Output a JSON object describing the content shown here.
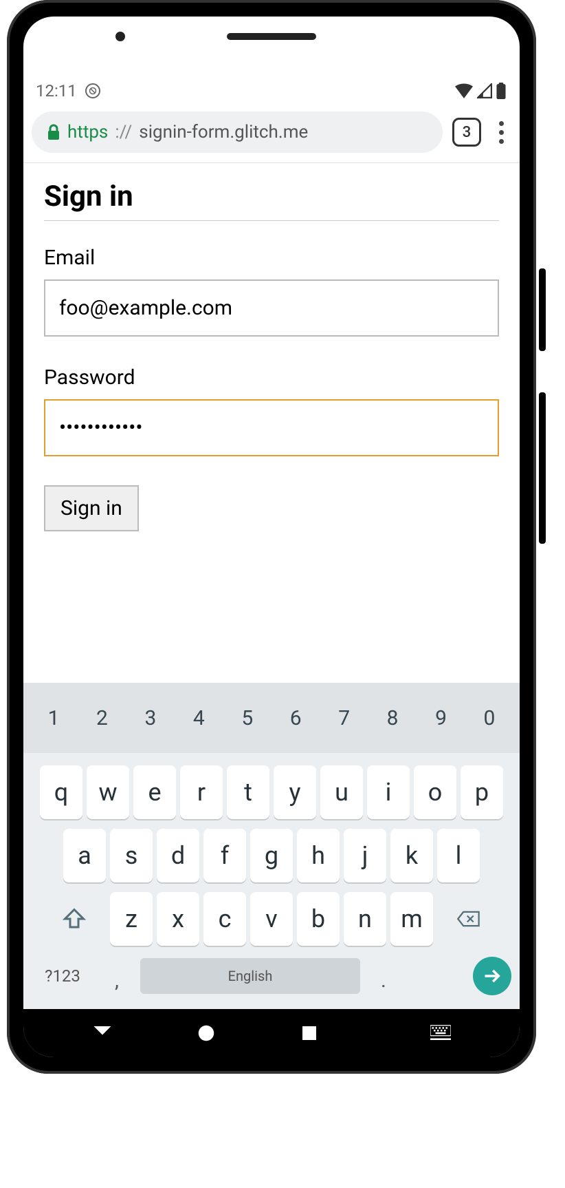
{
  "status": {
    "time": "12:11"
  },
  "browser": {
    "url_scheme": "https",
    "url_sep": "://",
    "url_host": "signin-form.glitch.me",
    "tab_count": "3"
  },
  "page": {
    "title": "Sign in",
    "email_label": "Email",
    "email_value": "foo@example.com",
    "password_label": "Password",
    "password_value": "••••••••••••",
    "submit_label": "Sign in"
  },
  "keyboard": {
    "numbers": [
      "1",
      "2",
      "3",
      "4",
      "5",
      "6",
      "7",
      "8",
      "9",
      "0"
    ],
    "row1": [
      "q",
      "w",
      "e",
      "r",
      "t",
      "y",
      "u",
      "i",
      "o",
      "p"
    ],
    "row2": [
      "a",
      "s",
      "d",
      "f",
      "g",
      "h",
      "j",
      "k",
      "l"
    ],
    "row3": [
      "z",
      "x",
      "c",
      "v",
      "b",
      "n",
      "m"
    ],
    "mode": "?123",
    "comma": ",",
    "space": "English",
    "period": "."
  }
}
